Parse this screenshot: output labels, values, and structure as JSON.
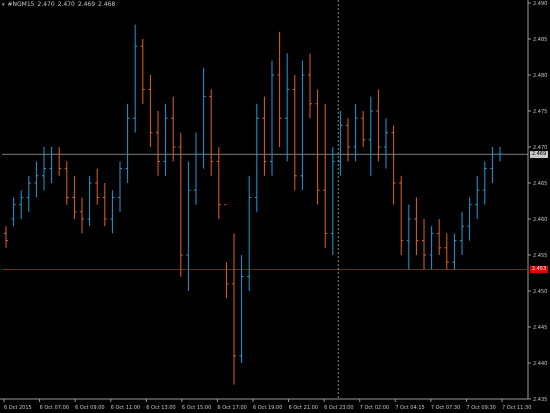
{
  "header": {
    "symbol_timeframe": "#NGM15",
    "ohlc": [
      "2.470",
      "2.470",
      "2.469",
      "2.468"
    ]
  },
  "colors": {
    "background": "#000000",
    "bull": "#1c9bd8",
    "bear": "#e0621f",
    "axis": "#9a9a9a",
    "text": "#c8c8c8",
    "ask_line": "#c8c8c8",
    "bid_line": "#e00000",
    "crosshair": "#c8c8c8"
  },
  "price_axis": {
    "min": 2.435,
    "max": 2.49,
    "labels": [
      "2.490",
      "2.485",
      "2.480",
      "2.475",
      "2.470",
      "2.465",
      "2.460",
      "2.455",
      "2.450",
      "2.445",
      "2.440",
      "2.435"
    ],
    "ask_tag": "2.469",
    "bid_tag": "2.453"
  },
  "time_axis": {
    "labels": [
      "6 Oct 2015",
      "6 Oct 07:00",
      "6 Oct 09:00",
      "6 Oct 11:00",
      "6 Oct 13:00",
      "6 Oct 15:00",
      "6 Oct 17:00",
      "6 Oct 19:00",
      "6 Oct 21:00",
      "6 Oct 23:00",
      "7 Oct 02:00",
      "7 Oct 04:15",
      "7 Oct 07:30",
      "7 Oct 09:30",
      "7 Oct 11:30"
    ]
  },
  "chart_data": {
    "type": "ohlc-bars",
    "instrument": "#NGM15",
    "ask_level": 2.469,
    "bid_level": 2.453,
    "crosshair_x": "6 Oct 23:00",
    "bars": [
      [
        2.458,
        2.459,
        2.456,
        2.457
      ],
      [
        2.46,
        2.463,
        2.459,
        2.462
      ],
      [
        2.462,
        2.464,
        2.46,
        2.463
      ],
      [
        2.463,
        2.466,
        2.461,
        2.465
      ],
      [
        2.465,
        2.468,
        2.463,
        2.466
      ],
      [
        2.466,
        2.47,
        2.464,
        2.467
      ],
      [
        2.467,
        2.47,
        2.465,
        2.469
      ],
      [
        2.469,
        2.47,
        2.466,
        2.467
      ],
      [
        2.467,
        2.468,
        2.462,
        2.463
      ],
      [
        2.463,
        2.466,
        2.46,
        2.461
      ],
      [
        2.461,
        2.463,
        2.458,
        2.46
      ],
      [
        2.46,
        2.466,
        2.459,
        2.465
      ],
      [
        2.465,
        2.467,
        2.462,
        2.463
      ],
      [
        2.463,
        2.465,
        2.459,
        2.46
      ],
      [
        2.46,
        2.464,
        2.458,
        2.463
      ],
      [
        2.463,
        2.468,
        2.461,
        2.467
      ],
      [
        2.467,
        2.476,
        2.465,
        2.474
      ],
      [
        2.474,
        2.487,
        2.472,
        2.484
      ],
      [
        2.484,
        2.485,
        2.476,
        2.478
      ],
      [
        2.478,
        2.48,
        2.47,
        2.472
      ],
      [
        2.472,
        2.475,
        2.466,
        2.468
      ],
      [
        2.468,
        2.476,
        2.466,
        2.474
      ],
      [
        2.474,
        2.477,
        2.468,
        2.47
      ],
      [
        2.47,
        2.472,
        2.452,
        2.455
      ],
      [
        2.455,
        2.468,
        2.45,
        2.464
      ],
      [
        2.464,
        2.472,
        2.462,
        2.469
      ],
      [
        2.469,
        2.481,
        2.467,
        2.477
      ],
      [
        2.477,
        2.478,
        2.466,
        2.468
      ],
      [
        2.468,
        2.47,
        2.46,
        2.462
      ],
      [
        2.462,
        2.454,
        2.449,
        2.451
      ],
      [
        2.451,
        2.458,
        2.437,
        2.441
      ],
      [
        2.441,
        2.455,
        2.44,
        2.452
      ],
      [
        2.452,
        2.466,
        2.45,
        2.463
      ],
      [
        2.463,
        2.476,
        2.461,
        2.474
      ],
      [
        2.474,
        2.477,
        2.466,
        2.468
      ],
      [
        2.468,
        2.482,
        2.466,
        2.48
      ],
      [
        2.48,
        2.486,
        2.47,
        2.474
      ],
      [
        2.474,
        2.483,
        2.468,
        2.478
      ],
      [
        2.478,
        2.48,
        2.464,
        2.466
      ],
      [
        2.466,
        2.482,
        2.464,
        2.48
      ],
      [
        2.48,
        2.483,
        2.474,
        2.476
      ],
      [
        2.476,
        2.478,
        2.462,
        2.464
      ],
      [
        2.464,
        2.476,
        2.456,
        2.458
      ],
      [
        2.458,
        2.47,
        2.455,
        2.468
      ],
      [
        2.468,
        2.475,
        2.466,
        2.473
      ],
      [
        2.473,
        2.474,
        2.468,
        2.47
      ],
      [
        2.47,
        2.476,
        2.468,
        2.474
      ],
      [
        2.474,
        2.475,
        2.47,
        2.471
      ],
      [
        2.471,
        2.477,
        2.466,
        2.475
      ],
      [
        2.475,
        2.478,
        2.468,
        2.47
      ],
      [
        2.47,
        2.474,
        2.467,
        2.472
      ],
      [
        2.472,
        2.473,
        2.462,
        2.465
      ],
      [
        2.465,
        2.466,
        2.455,
        2.457
      ],
      [
        2.457,
        2.462,
        2.453,
        2.46
      ],
      [
        2.46,
        2.463,
        2.455,
        2.457
      ],
      [
        2.457,
        2.46,
        2.453,
        2.455
      ],
      [
        2.455,
        2.459,
        2.453,
        2.458
      ],
      [
        2.458,
        2.46,
        2.455,
        2.456
      ],
      [
        2.456,
        2.458,
        2.453,
        2.454
      ],
      [
        2.454,
        2.458,
        2.453,
        2.457
      ],
      [
        2.457,
        2.461,
        2.455,
        2.459
      ],
      [
        2.459,
        2.463,
        2.457,
        2.462
      ],
      [
        2.462,
        2.466,
        2.46,
        2.464
      ],
      [
        2.464,
        2.468,
        2.462,
        2.467
      ],
      [
        2.467,
        2.47,
        2.465,
        2.469
      ],
      [
        2.469,
        2.47,
        2.468,
        2.469
      ]
    ]
  }
}
